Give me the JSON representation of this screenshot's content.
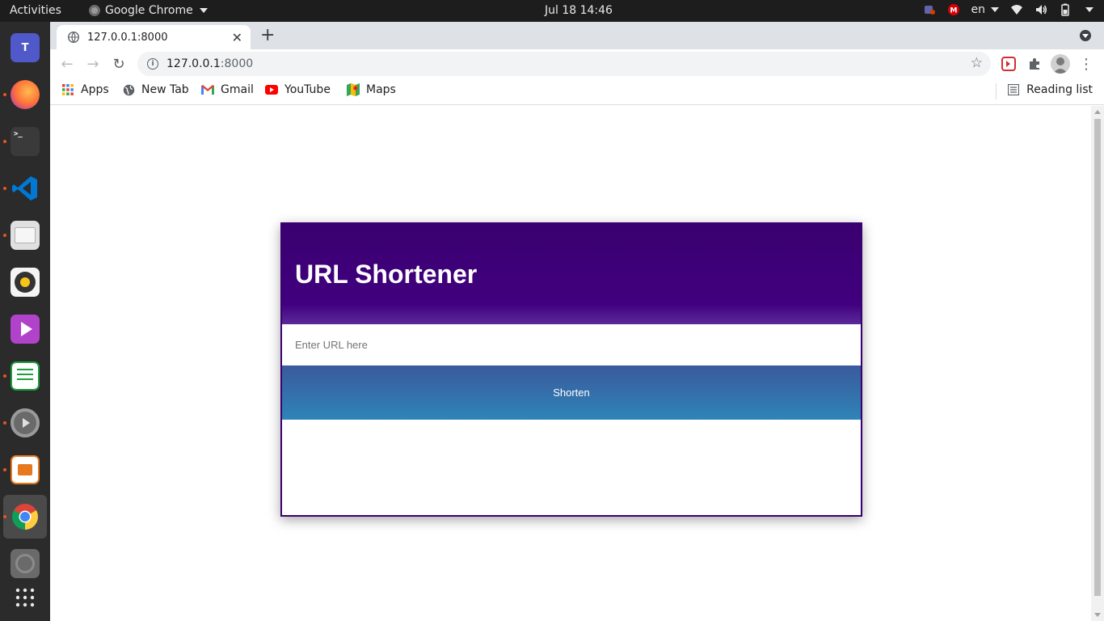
{
  "topbar": {
    "activities": "Activities",
    "app_name": "Google Chrome",
    "clock": "Jul 18  14:46",
    "language": "en"
  },
  "dock": {
    "items": [
      {
        "name": "teams",
        "icon": "microsoft-teams-icon",
        "color": "#5059c9",
        "running": false
      },
      {
        "name": "firefox",
        "icon": "firefox-icon",
        "color": "#ff7139",
        "running": true
      },
      {
        "name": "terminal",
        "icon": "terminal-icon",
        "color": "#3a3a3a",
        "running": true
      },
      {
        "name": "vscode",
        "icon": "vscode-icon",
        "color": "#0078d4",
        "running": true
      },
      {
        "name": "files",
        "icon": "files-icon",
        "color": "#e0e0e0",
        "running": true
      },
      {
        "name": "rhythmbox",
        "icon": "rhythmbox-icon",
        "color": "#f4f4f4",
        "running": false
      },
      {
        "name": "video",
        "icon": "video-player-icon",
        "color": "#b043c9",
        "running": false
      },
      {
        "name": "calc",
        "icon": "spreadsheet-icon",
        "color": "#1d9f3f",
        "running": true
      },
      {
        "name": "settings",
        "icon": "settings-icon",
        "color": "#8a8a8a",
        "running": true
      },
      {
        "name": "impress",
        "icon": "presentation-icon",
        "color": "#e6781e",
        "running": true
      },
      {
        "name": "chrome",
        "icon": "chrome-icon",
        "color": "#4285f4",
        "running": true
      },
      {
        "name": "disc",
        "icon": "disc-icon",
        "color": "#6a6a6a",
        "running": false
      }
    ]
  },
  "browser": {
    "tab_title": "127.0.0.1:8000",
    "url_host": "127.0.0.1",
    "url_port": ":8000",
    "bookmarks": [
      {
        "label": "Apps",
        "icon": "apps-grid-icon"
      },
      {
        "label": "New Tab",
        "icon": "globe-icon"
      },
      {
        "label": "Gmail",
        "icon": "gmail-icon"
      },
      {
        "label": "YouTube",
        "icon": "youtube-icon"
      },
      {
        "label": "Maps",
        "icon": "maps-icon"
      }
    ],
    "reading_list": "Reading list"
  },
  "page": {
    "title": "URL Shortener",
    "input_placeholder": "Enter URL here",
    "button_label": "Shorten"
  },
  "colors": {
    "header_purple": "#3a0070",
    "button_blue_top": "#3a5a9c",
    "button_blue_bottom": "#2e84b8"
  }
}
